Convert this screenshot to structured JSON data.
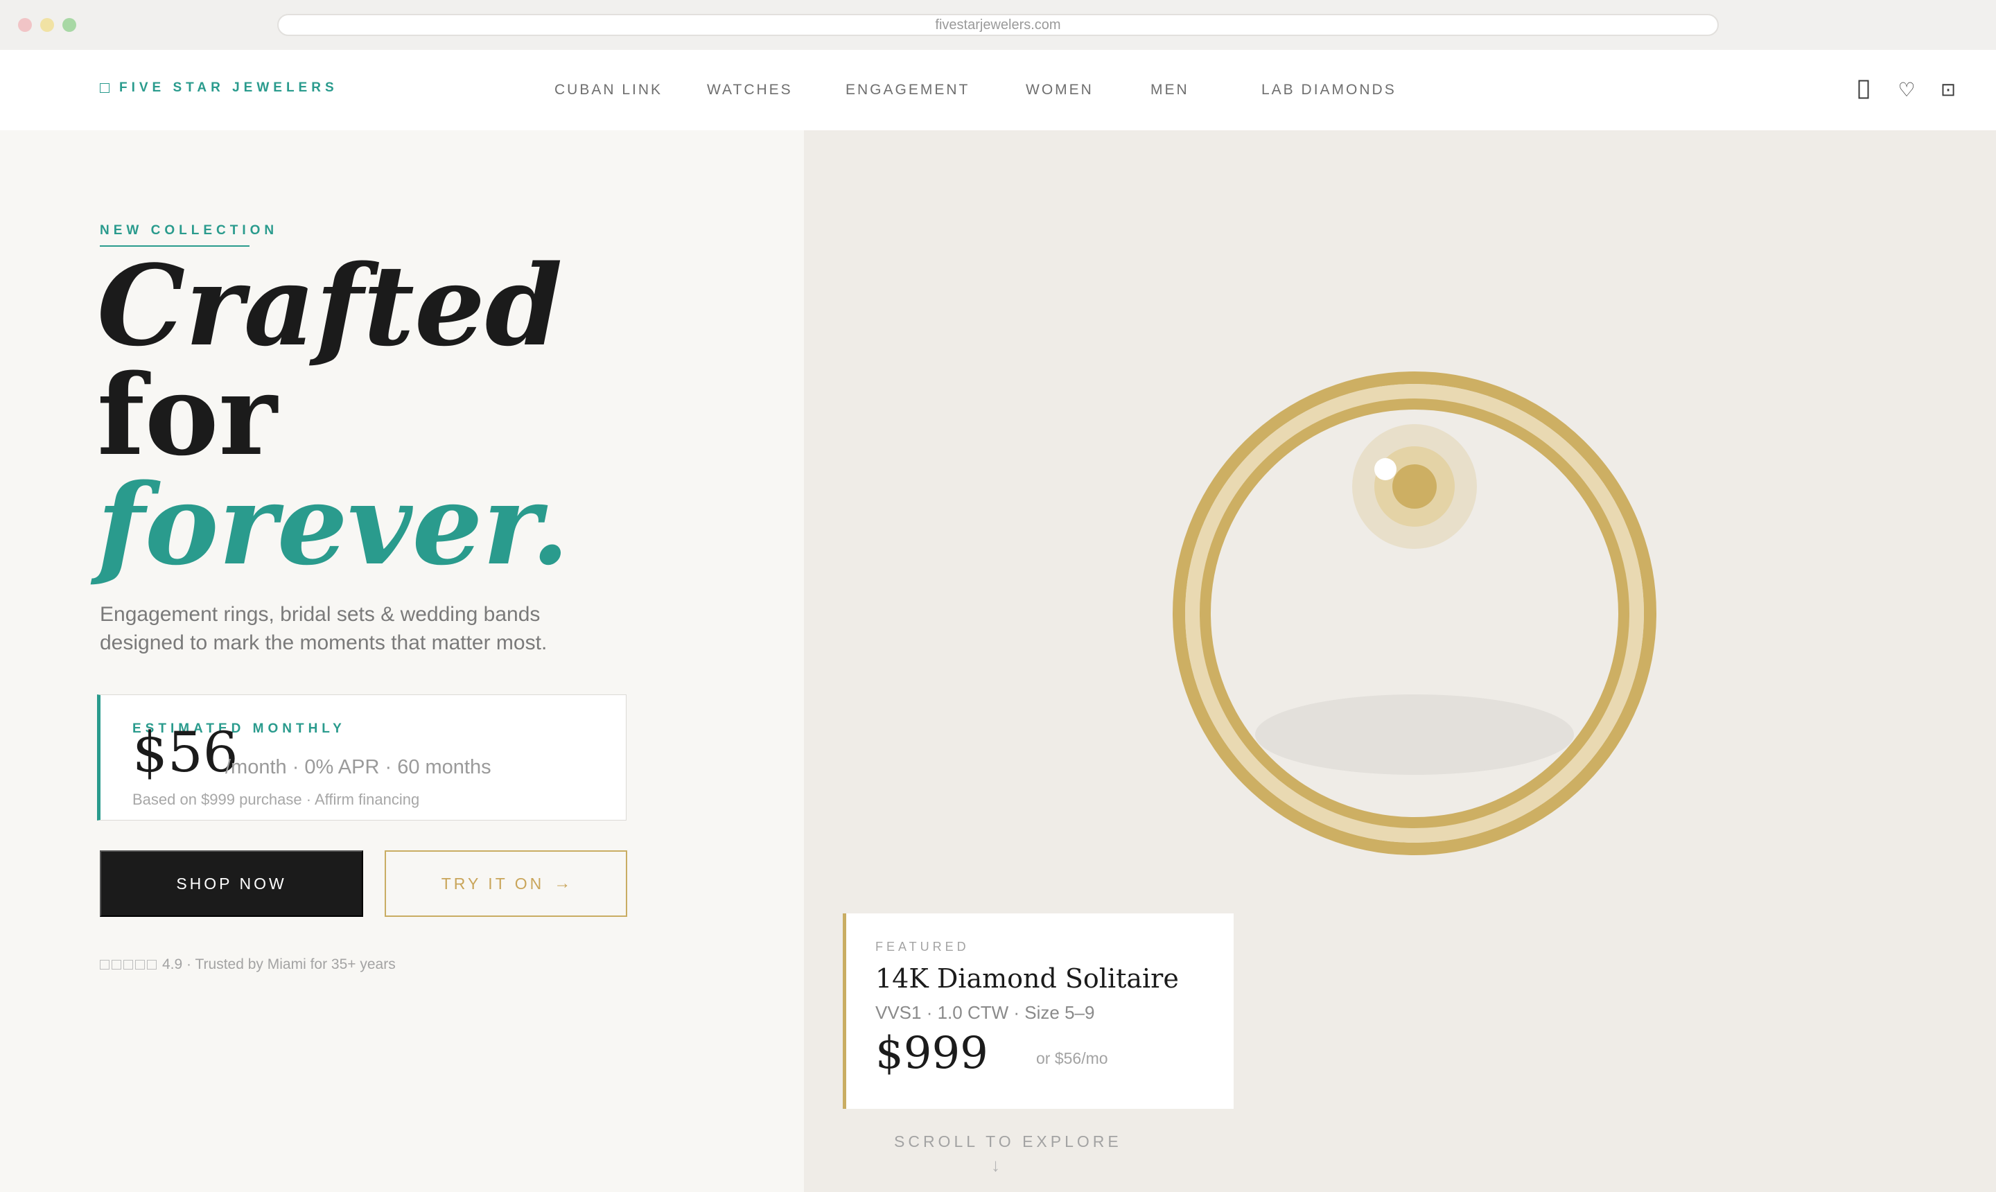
{
  "browser": {
    "url": "fivestarjewelers.com"
  },
  "brand": {
    "name": "FIVE STAR JEWELERS",
    "accent": "#2a9b8d",
    "gold": "#c9ad63"
  },
  "nav": {
    "links": [
      {
        "label": "CUBAN LINK"
      },
      {
        "label": "WATCHES"
      },
      {
        "label": "ENGAGEMENT"
      },
      {
        "label": "WOMEN"
      },
      {
        "label": "MEN"
      },
      {
        "label": "LAB DIAMONDS"
      }
    ],
    "icons": [
      "account-icon",
      "heart-icon",
      "bag-icon"
    ],
    "heart_glyph": "♡",
    "bag_glyph": "⊡"
  },
  "hero": {
    "eyebrow": "NEW COLLECTION",
    "headline": {
      "line1": "Crafted",
      "line2": "for",
      "line3": "forever."
    },
    "subcopy": "Engagement rings, bridal sets & wedding bands designed to mark the moments that matter most."
  },
  "estimate": {
    "label": "ESTIMATED MONTHLY",
    "amount": "$56",
    "terms": "/month · 0% APR · 60 months",
    "note": "Based on $999 purchase · Affirm financing"
  },
  "actions": {
    "shop": "SHOP NOW",
    "try": "TRY IT ON",
    "try_arrow": "→"
  },
  "rating": {
    "stars": 5,
    "text": "4.9 · Trusted by Miami for 35+ years"
  },
  "featured": {
    "label": "FEATURED",
    "title": "14K Diamond Solitaire",
    "spec": "VVS1 · 1.0 CTW · Size 5–9",
    "price": "$999",
    "monthly": "or $56/mo"
  },
  "scroll": {
    "label": "SCROLL TO EXPLORE",
    "arrow": "↓"
  }
}
